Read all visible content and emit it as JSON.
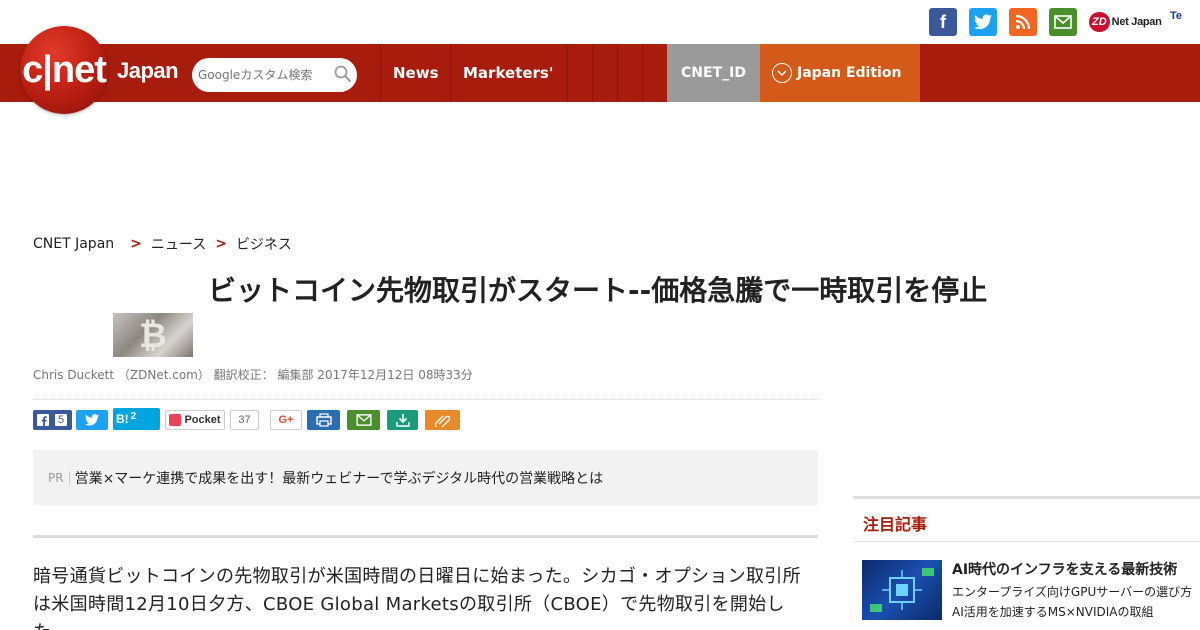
{
  "header": {
    "logo_text": "c|net",
    "logo_sub": "Japan",
    "search_placeholder": "Googleカスタム検索",
    "nav_items": [
      "News",
      "Marketers'"
    ],
    "cnet_id": "CNET_ID",
    "edition": "Japan Edition",
    "zdnet_badge": "ZD",
    "zdnet_text": "Net Japan",
    "tech_text": "Te"
  },
  "social_icons": [
    "facebook-icon",
    "twitter-icon",
    "rss-icon",
    "mail-icon"
  ],
  "breadcrumb": [
    "CNET Japan",
    "ニュース",
    "ビジネス"
  ],
  "article": {
    "headline": "ビットコイン先物取引がスタート--価格急騰で一時取引を停止",
    "byline": "Chris Duckett （ZDNet.com） 翻訳校正： 編集部 2017年12月12日 08時33分",
    "lead": "暗号通貨ビットコインの先物取引が米国時間の日曜日に始まった。シカゴ・オプション取引所は米国時間12月10日夕方、CBOE Global Marketsの取引所（CBOE）で先物取引を開始した。"
  },
  "share": {
    "facebook_count": "5",
    "hatena_label": "B!",
    "hatena_count": "2",
    "pocket_label": "Pocket",
    "pocket_count": "37",
    "gplus_label": "G+"
  },
  "pr": {
    "label": "PR",
    "text": "営業×マーケ連携で成果を出す！最新ウェビナーで学ぶデジタル時代の営業戦略とは"
  },
  "sidebar": {
    "title": "注目記事",
    "item_headline": "AI時代のインフラを支える最新技術",
    "item_sub1": "エンタープライズ向けGPUサーバーの選び方",
    "item_sub2": "AI活用を加速するMS×NVIDIAの取組"
  },
  "colors": {
    "brand_red": "#a81c0d",
    "edition_orange": "#d45a1a",
    "cnetid_gray": "#9a9a9a"
  }
}
